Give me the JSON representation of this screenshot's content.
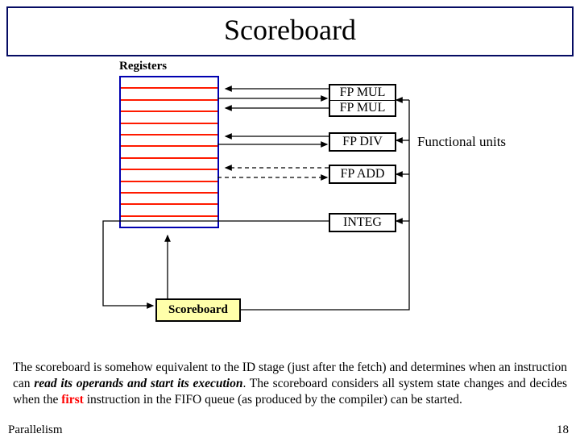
{
  "title": "Scoreboard",
  "registersLabel": "Registers",
  "fpMul1": "FP MUL",
  "fpMul2": "FP MUL",
  "fpDiv": "FP DIV",
  "fpAdd": "FP ADD",
  "integ": "INTEG",
  "functionalUnitsLabel": "Functional units",
  "scoreboardBox": "Scoreboard",
  "descPre": "The scoreboard is somehow equivalent to the ID stage (just after the fetch) and determines when an instruction can ",
  "descEm": "read its operands and start its execution",
  "descMid": ". The scoreboard considers all system state changes and decides when the ",
  "descFirst": "first",
  "descPost": " instruction in the FIFO queue (as produced by the compiler) can be started.",
  "footerTopic": "Parallelism",
  "pageNumber": "18"
}
